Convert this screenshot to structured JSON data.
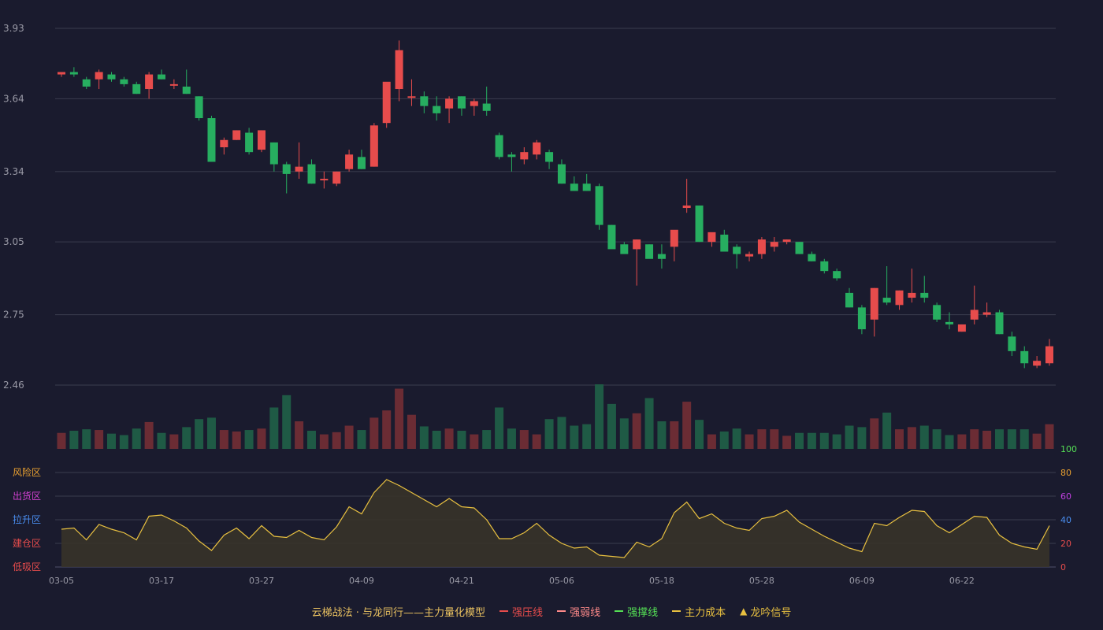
{
  "colors": {
    "background": "#1a1b2e",
    "up": "#e74c4c",
    "down": "#27ae60",
    "volume_up": "#6b2c34",
    "volume_down": "#1f5a45",
    "grid": "#3a3c4e",
    "axis_text": "#9a9aa6",
    "line": "#e8c040",
    "area": "#3a3428"
  },
  "legend": {
    "title": "云梯战法 · 与龙同行——主力量化模型",
    "items": [
      {
        "label": "强压线",
        "style": "solid",
        "color": "#e74c4c"
      },
      {
        "label": "强弱线",
        "style": "dash",
        "color": "#ff8a8a"
      },
      {
        "label": "强撑线",
        "style": "solid",
        "color": "#55e055"
      },
      {
        "label": "主力成本",
        "style": "dash",
        "color": "#e8c040"
      },
      {
        "label": "龙吟信号",
        "style": "triangle",
        "color": "#e8c040"
      }
    ]
  },
  "chart_data": [
    {
      "type": "candlestick",
      "title": "",
      "y_ticks": [
        "3.93",
        "3.64",
        "3.34",
        "3.05",
        "2.75",
        "2.46"
      ],
      "ylim": [
        2.46,
        3.93
      ],
      "x_ticks": [
        {
          "index": 0,
          "label": "03-05"
        },
        {
          "index": 8,
          "label": "03-17"
        },
        {
          "index": 16,
          "label": "03-27"
        },
        {
          "index": 24,
          "label": "04-09"
        },
        {
          "index": 32,
          "label": "04-21"
        },
        {
          "index": 40,
          "label": "05-06"
        },
        {
          "index": 48,
          "label": "05-18"
        },
        {
          "index": 56,
          "label": "05-28"
        },
        {
          "index": 64,
          "label": "06-09"
        },
        {
          "index": 72,
          "label": "06-22"
        }
      ],
      "ohlc": [
        [
          3.74,
          3.75,
          3.73,
          3.75
        ],
        [
          3.75,
          3.77,
          3.73,
          3.74
        ],
        [
          3.72,
          3.73,
          3.68,
          3.69
        ],
        [
          3.72,
          3.76,
          3.68,
          3.75
        ],
        [
          3.74,
          3.75,
          3.71,
          3.72
        ],
        [
          3.72,
          3.73,
          3.69,
          3.7
        ],
        [
          3.7,
          3.71,
          3.66,
          3.66
        ],
        [
          3.68,
          3.75,
          3.64,
          3.74
        ],
        [
          3.74,
          3.76,
          3.72,
          3.72
        ],
        [
          3.7,
          3.72,
          3.68,
          3.7
        ],
        [
          3.69,
          3.76,
          3.66,
          3.66
        ],
        [
          3.65,
          3.65,
          3.55,
          3.56
        ],
        [
          3.56,
          3.57,
          3.38,
          3.38
        ],
        [
          3.44,
          3.48,
          3.41,
          3.47
        ],
        [
          3.47,
          3.51,
          3.47,
          3.51
        ],
        [
          3.5,
          3.52,
          3.41,
          3.42
        ],
        [
          3.43,
          3.51,
          3.42,
          3.51
        ],
        [
          3.46,
          3.46,
          3.34,
          3.37
        ],
        [
          3.37,
          3.38,
          3.25,
          3.33
        ],
        [
          3.34,
          3.46,
          3.31,
          3.36
        ],
        [
          3.37,
          3.39,
          3.29,
          3.29
        ],
        [
          3.31,
          3.34,
          3.27,
          3.31
        ],
        [
          3.29,
          3.34,
          3.28,
          3.34
        ],
        [
          3.35,
          3.43,
          3.34,
          3.41
        ],
        [
          3.4,
          3.43,
          3.35,
          3.35
        ],
        [
          3.36,
          3.54,
          3.36,
          3.53
        ],
        [
          3.54,
          3.67,
          3.52,
          3.71
        ],
        [
          3.68,
          3.88,
          3.63,
          3.84
        ],
        [
          3.65,
          3.72,
          3.61,
          3.65
        ],
        [
          3.65,
          3.67,
          3.58,
          3.61
        ],
        [
          3.61,
          3.65,
          3.55,
          3.58
        ],
        [
          3.6,
          3.65,
          3.54,
          3.64
        ],
        [
          3.65,
          3.65,
          3.57,
          3.6
        ],
        [
          3.61,
          3.64,
          3.57,
          3.63
        ],
        [
          3.62,
          3.69,
          3.57,
          3.59
        ],
        [
          3.49,
          3.5,
          3.39,
          3.4
        ],
        [
          3.41,
          3.42,
          3.34,
          3.4
        ],
        [
          3.39,
          3.44,
          3.37,
          3.42
        ],
        [
          3.41,
          3.47,
          3.39,
          3.46
        ],
        [
          3.42,
          3.43,
          3.35,
          3.38
        ],
        [
          3.37,
          3.39,
          3.29,
          3.29
        ],
        [
          3.29,
          3.32,
          3.26,
          3.26
        ],
        [
          3.29,
          3.33,
          3.26,
          3.26
        ],
        [
          3.28,
          3.29,
          3.1,
          3.12
        ],
        [
          3.12,
          3.12,
          3.03,
          3.02
        ],
        [
          3.04,
          3.05,
          3.01,
          3.0
        ],
        [
          3.02,
          3.06,
          2.87,
          3.06
        ],
        [
          3.04,
          3.04,
          2.99,
          2.98
        ],
        [
          3.0,
          3.04,
          2.94,
          2.98
        ],
        [
          3.03,
          3.06,
          2.97,
          3.1
        ],
        [
          3.19,
          3.31,
          3.17,
          3.2
        ],
        [
          3.2,
          3.2,
          3.05,
          3.05
        ],
        [
          3.05,
          3.08,
          3.03,
          3.09
        ],
        [
          3.08,
          3.1,
          3.01,
          3.01
        ],
        [
          3.03,
          3.04,
          2.94,
          3.0
        ],
        [
          2.99,
          3.01,
          2.97,
          3.0
        ],
        [
          3.0,
          3.07,
          2.98,
          3.06
        ],
        [
          3.03,
          3.07,
          3.01,
          3.05
        ],
        [
          3.05,
          3.06,
          3.04,
          3.06
        ],
        [
          3.05,
          3.05,
          3.0,
          3.0
        ],
        [
          3.0,
          3.01,
          2.97,
          2.97
        ],
        [
          2.97,
          2.98,
          2.92,
          2.93
        ],
        [
          2.93,
          2.94,
          2.89,
          2.9
        ],
        [
          2.84,
          2.86,
          2.78,
          2.78
        ],
        [
          2.78,
          2.79,
          2.67,
          2.69
        ],
        [
          2.73,
          2.86,
          2.66,
          2.86
        ],
        [
          2.82,
          2.95,
          2.79,
          2.8
        ],
        [
          2.79,
          2.85,
          2.77,
          2.85
        ],
        [
          2.82,
          2.94,
          2.8,
          2.84
        ],
        [
          2.84,
          2.91,
          2.8,
          2.82
        ],
        [
          2.79,
          2.8,
          2.72,
          2.73
        ],
        [
          2.72,
          2.76,
          2.69,
          2.71
        ],
        [
          2.68,
          2.71,
          2.68,
          2.71
        ],
        [
          2.73,
          2.87,
          2.71,
          2.77
        ],
        [
          2.75,
          2.8,
          2.74,
          2.76
        ],
        [
          2.76,
          2.77,
          2.67,
          2.67
        ],
        [
          2.66,
          2.68,
          2.58,
          2.6
        ],
        [
          2.6,
          2.62,
          2.53,
          2.55
        ],
        [
          2.54,
          2.58,
          2.53,
          2.56
        ],
        [
          2.55,
          2.65,
          2.54,
          2.62
        ]
      ]
    },
    {
      "type": "bar",
      "title": "",
      "volume": [
        22,
        25,
        27,
        26,
        21,
        19,
        28,
        37,
        22,
        20,
        30,
        41,
        43,
        26,
        24,
        26,
        28,
        57,
        74,
        38,
        25,
        20,
        23,
        32,
        26,
        43,
        53,
        83,
        47,
        31,
        25,
        28,
        25,
        20,
        26,
        57,
        28,
        26,
        20,
        41,
        44,
        32,
        34,
        89,
        62,
        42,
        49,
        70,
        38,
        38,
        65,
        40,
        20,
        24,
        28,
        20,
        27,
        27,
        18,
        22,
        22,
        22,
        20,
        32,
        30,
        42,
        50,
        27,
        30,
        32,
        27,
        19,
        20,
        27,
        25,
        27,
        27,
        27,
        21,
        34
      ]
    },
    {
      "type": "area",
      "title": "",
      "y_ticks": [
        "0",
        "20",
        "40",
        "60",
        "80",
        "100"
      ],
      "ylim": [
        0,
        100
      ],
      "zone_labels": [
        "风险区",
        "出货区",
        "拉升区",
        "建仓区",
        "低吸区"
      ],
      "values": [
        32,
        33,
        23,
        36,
        32,
        29,
        23,
        43,
        44,
        39,
        33,
        22,
        14,
        27,
        33,
        24,
        35,
        26,
        25,
        31,
        25,
        23,
        34,
        51,
        45,
        63,
        74,
        69,
        63,
        57,
        51,
        58,
        51,
        50,
        40,
        24,
        24,
        29,
        37,
        27,
        20,
        16,
        17,
        10,
        9,
        8,
        21,
        17,
        24,
        46,
        55,
        41,
        45,
        37,
        33,
        31,
        41,
        43,
        48,
        38,
        32,
        26,
        21,
        16,
        13,
        37,
        35,
        42,
        48,
        47,
        35,
        29,
        36,
        43,
        42,
        27,
        20,
        17,
        15,
        35
      ]
    }
  ]
}
